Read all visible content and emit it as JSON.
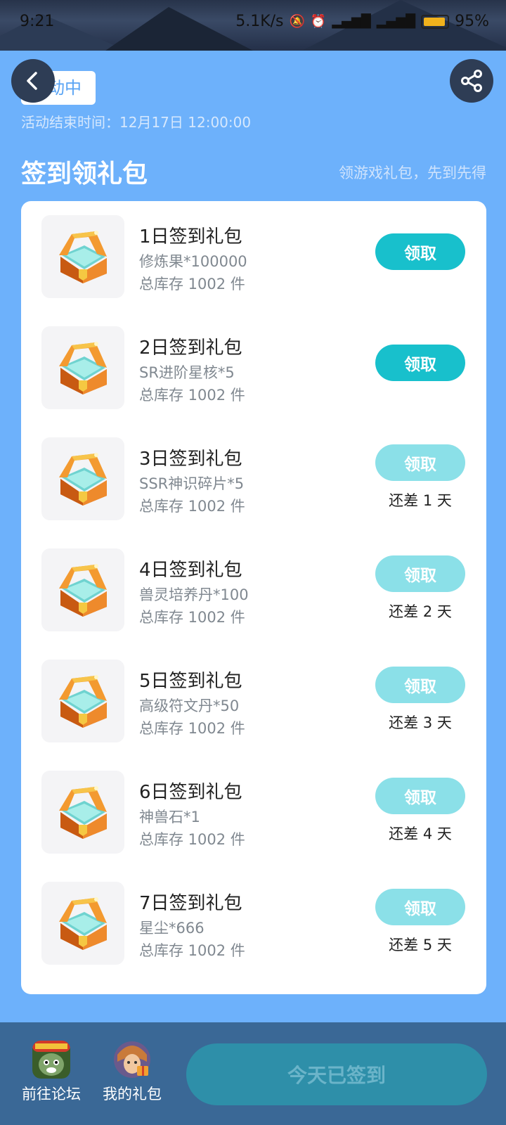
{
  "status_bar": {
    "time": "9:21",
    "network_speed": "5.1K/s",
    "battery": "95%",
    "battery_level": 0.95
  },
  "header": {
    "status_label": "活动中",
    "end_time": "活动结束时间：12月17日 12:00:00",
    "section_title": "签到领礼包",
    "section_subtitle": "领游戏礼包，先到先得"
  },
  "gifts": [
    {
      "title": "1日签到礼包",
      "item": "修炼果*100000",
      "stock": "总库存 1002 件",
      "button": "领取",
      "enabled": true,
      "remaining": ""
    },
    {
      "title": "2日签到礼包",
      "item": "SR进阶星核*5",
      "stock": "总库存 1002 件",
      "button": "领取",
      "enabled": true,
      "remaining": ""
    },
    {
      "title": "3日签到礼包",
      "item": "SSR神识碎片*5",
      "stock": "总库存 1002 件",
      "button": "领取",
      "enabled": false,
      "remaining": "还差 1 天"
    },
    {
      "title": "4日签到礼包",
      "item": "兽灵培养丹*100",
      "stock": "总库存 1002 件",
      "button": "领取",
      "enabled": false,
      "remaining": "还差 2 天"
    },
    {
      "title": "5日签到礼包",
      "item": "高级符文丹*50",
      "stock": "总库存 1002 件",
      "button": "领取",
      "enabled": false,
      "remaining": "还差 3 天"
    },
    {
      "title": "6日签到礼包",
      "item": "神兽石*1",
      "stock": "总库存 1002 件",
      "button": "领取",
      "enabled": false,
      "remaining": "还差 4 天"
    },
    {
      "title": "7日签到礼包",
      "item": "星尘*666",
      "stock": "总库存 1002 件",
      "button": "领取",
      "enabled": false,
      "remaining": "还差 5 天"
    }
  ],
  "bottom_bar": {
    "forum_label": "前往论坛",
    "gifts_label": "我的礼包",
    "signed_label": "今天已签到"
  },
  "colors": {
    "background": "#6db1fb",
    "accent": "#18c0cc",
    "accent_disabled": "#8be0e8",
    "bottom_bar": "#3a6896"
  }
}
